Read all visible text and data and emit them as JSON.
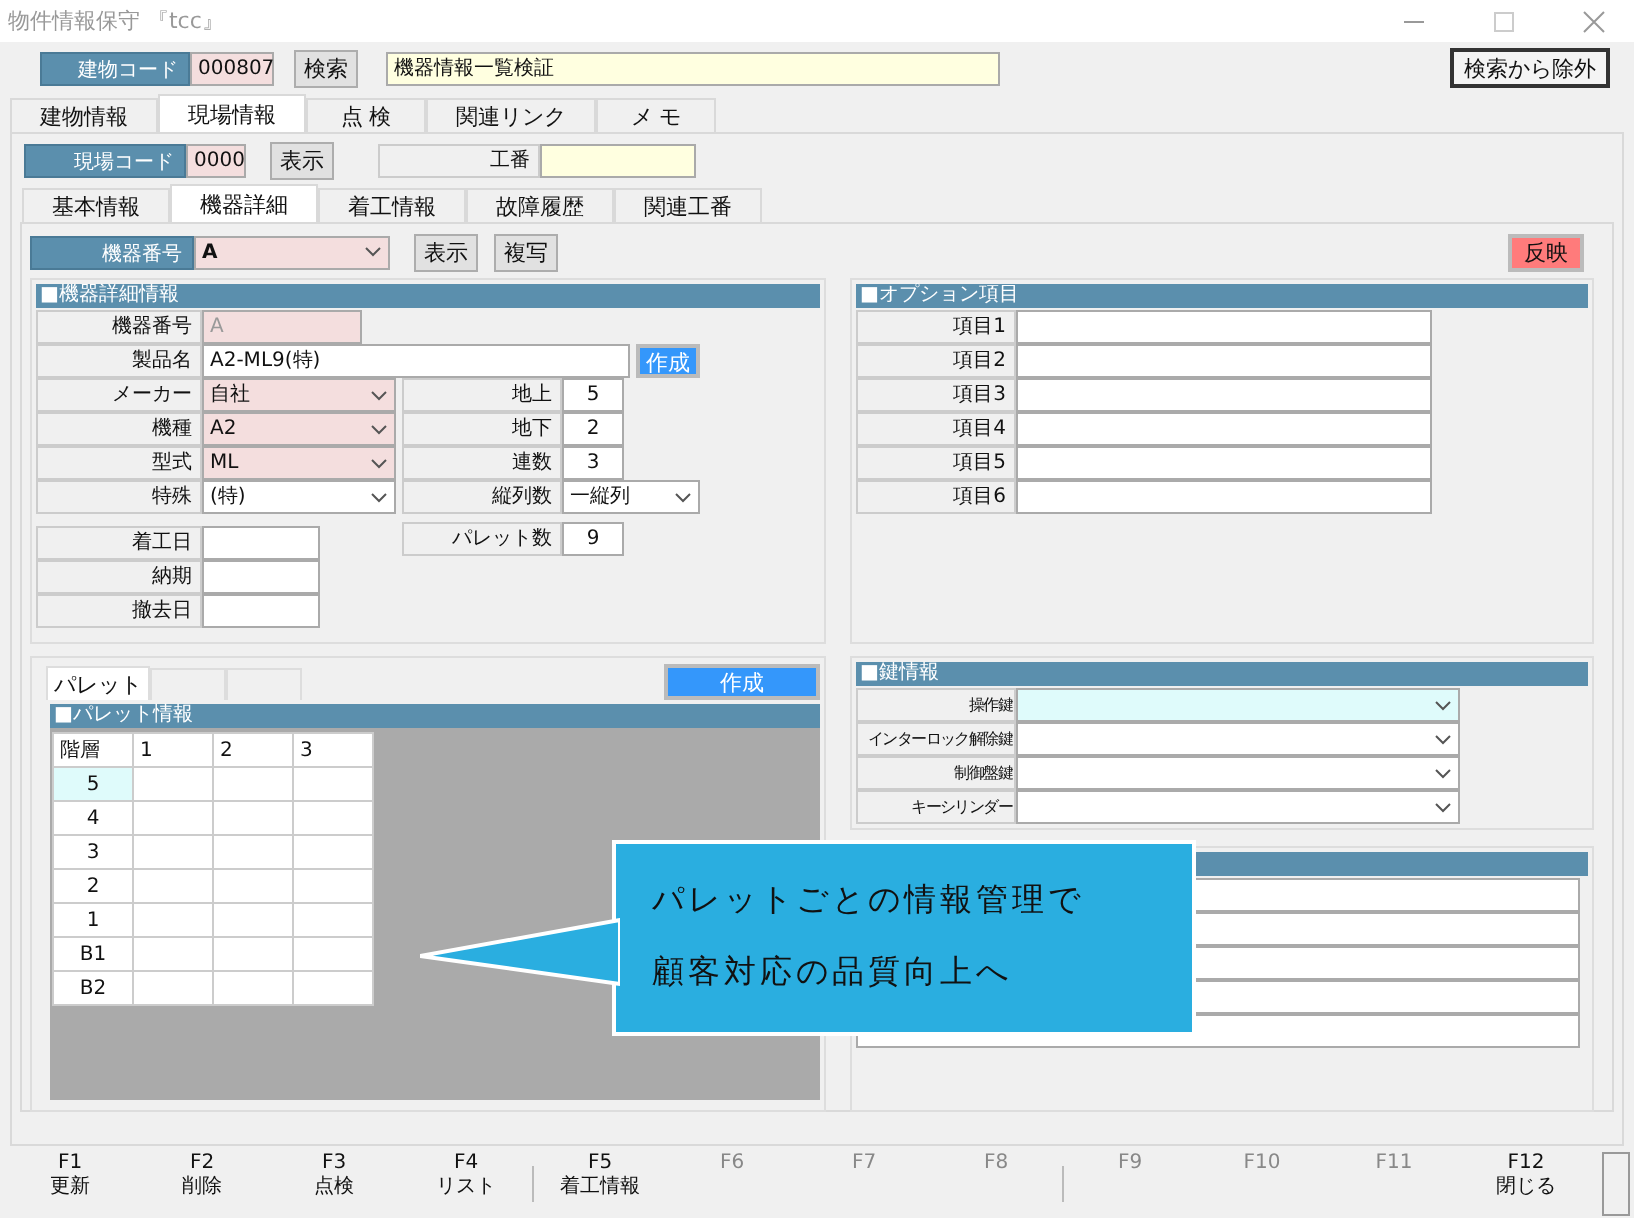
{
  "window": {
    "title": "物件情報保守 『tcc』"
  },
  "building": {
    "label": "建物コード",
    "code": "000807",
    "search_button": "検索",
    "name": "機器情報一覧検証",
    "exclude_button": "検索から除外"
  },
  "tabs": [
    {
      "label": "建物情報",
      "selected": false
    },
    {
      "label": "現場情報",
      "selected": true
    },
    {
      "label": "点 検",
      "selected": false
    },
    {
      "label": "関連リンク",
      "selected": false
    },
    {
      "label": "メ モ",
      "selected": false
    }
  ],
  "site": {
    "label": "現場コード",
    "code": "0000",
    "show_button": "表示",
    "work_no_label": "工番"
  },
  "sub_tabs": [
    {
      "label": "基本情報",
      "selected": false
    },
    {
      "label": "機器詳細",
      "selected": true
    },
    {
      "label": "着工情報",
      "selected": false
    },
    {
      "label": "故障履歴",
      "selected": false
    },
    {
      "label": "関連工番",
      "selected": false
    }
  ],
  "device_bar": {
    "label": "機器番号",
    "value": "A",
    "show_button": "表示",
    "copy_button": "複写",
    "apply_button": "反映"
  },
  "detail": {
    "title": "■機器詳細情報",
    "left_fields": [
      {
        "kind": "text",
        "label": "機器番号",
        "value": "A",
        "disabled": true
      },
      {
        "kind": "wide",
        "label": "製品名",
        "value": "A2-ML9(特)",
        "button": "作成"
      },
      {
        "kind": "combo",
        "label": "メーカー",
        "value": "自社",
        "required": true
      },
      {
        "kind": "combo",
        "label": "機種",
        "value": "A2",
        "required": true
      },
      {
        "kind": "combo",
        "label": "型式",
        "value": "ML",
        "required": true
      },
      {
        "kind": "combo",
        "label": "特殊",
        "value": "(特)",
        "required": false
      }
    ],
    "right_fields": [
      {
        "kind": "text",
        "label": "地上",
        "value": "5"
      },
      {
        "kind": "text",
        "label": "地下",
        "value": "2"
      },
      {
        "kind": "text",
        "label": "連数",
        "value": "3"
      },
      {
        "kind": "combo",
        "label": "縦列数",
        "value": "一縦列"
      },
      {
        "kind": "text",
        "label": "パレット数",
        "value": "9"
      }
    ],
    "date_fields": [
      {
        "label": "着工日"
      },
      {
        "label": "納期"
      },
      {
        "label": "撤去日"
      }
    ]
  },
  "options": {
    "title": "■オプション項目",
    "items": [
      "項目1",
      "項目2",
      "項目3",
      "項目4",
      "項目5",
      "項目6"
    ]
  },
  "pallet": {
    "tab": "パレット",
    "create_button": "作成",
    "title": "■パレット情報",
    "columns": [
      "階層",
      "1",
      "2",
      "3"
    ],
    "rows": [
      {
        "label": "5",
        "selected": true
      },
      {
        "label": "4",
        "selected": false
      },
      {
        "label": "3",
        "selected": false
      },
      {
        "label": "2",
        "selected": false
      },
      {
        "label": "1",
        "selected": false
      },
      {
        "label": "B1",
        "selected": false
      },
      {
        "label": "B2",
        "selected": false
      }
    ]
  },
  "keys": {
    "title": "■鍵情報",
    "items": [
      {
        "label": "操作鍵",
        "selected": true
      },
      {
        "label": "インターロック解除鍵",
        "selected": false
      },
      {
        "label": "制御盤鍵",
        "selected": false
      },
      {
        "label": "キーシリンダー",
        "selected": false
      }
    ]
  },
  "callout": {
    "lines": [
      "パレットごとの情報管理で",
      "顧客対応の品質向上へ"
    ]
  },
  "function_keys": [
    {
      "key": "F1",
      "label": "更新",
      "disabled": false
    },
    {
      "key": "F2",
      "label": "削除",
      "disabled": false
    },
    {
      "key": "F3",
      "label": "点検",
      "disabled": false
    },
    {
      "key": "F4",
      "label": "リスト",
      "disabled": false
    },
    {
      "key": "F5",
      "label": "着工情報",
      "disabled": false
    },
    {
      "key": "F6",
      "disabled": true
    },
    {
      "key": "F7",
      "disabled": true
    },
    {
      "key": "F8",
      "disabled": true
    },
    {
      "key": "F9",
      "disabled": true
    },
    {
      "key": "F10",
      "disabled": true
    },
    {
      "key": "F11",
      "disabled": true
    },
    {
      "key": "F12",
      "label": "閉じる",
      "disabled": false
    }
  ]
}
